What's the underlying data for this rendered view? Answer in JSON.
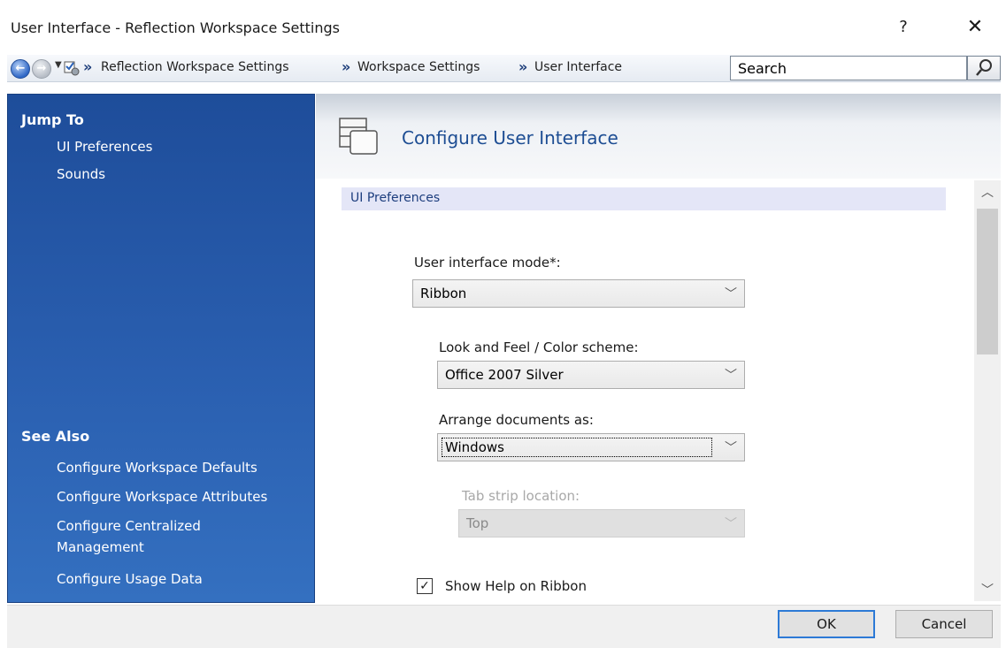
{
  "window": {
    "title": "User Interface - Reflection Workspace Settings",
    "help_glyph": "?",
    "close_glyph": "✕"
  },
  "navbar": {
    "breadcrumbs": [
      "Reflection Workspace Settings",
      "Workspace Settings",
      "User Interface"
    ],
    "separator": "»",
    "search_placeholder": "Search"
  },
  "leftpane": {
    "jump_to": {
      "heading": "Jump To",
      "items": [
        "UI Preferences",
        "Sounds"
      ]
    },
    "see_also": {
      "heading": "See Also",
      "items": [
        "Configure Workspace Defaults",
        "Configure Workspace Attributes",
        "Configure Centralized",
        "Management",
        "Configure Usage Data"
      ]
    }
  },
  "main": {
    "header_title": "Configure User Interface",
    "section_title": "UI Preferences",
    "ui_mode": {
      "label": "User interface mode*:",
      "value": "Ribbon"
    },
    "color_scheme": {
      "label": "Look and Feel / Color scheme:",
      "value": "Office 2007 Silver"
    },
    "arrange": {
      "label": "Arrange documents as:",
      "value": "Windows"
    },
    "tab_strip": {
      "label": "Tab strip location:",
      "value": "Top",
      "enabled": false
    },
    "show_help": {
      "label": "Show Help on Ribbon",
      "checked": true
    }
  },
  "buttons": {
    "ok": "OK",
    "cancel": "Cancel"
  },
  "colors": {
    "left_pane": "#2a5fb0",
    "header_title": "#1d4d93",
    "section_bar": "#e4e6f7",
    "ok_border": "#2d7ad6"
  }
}
